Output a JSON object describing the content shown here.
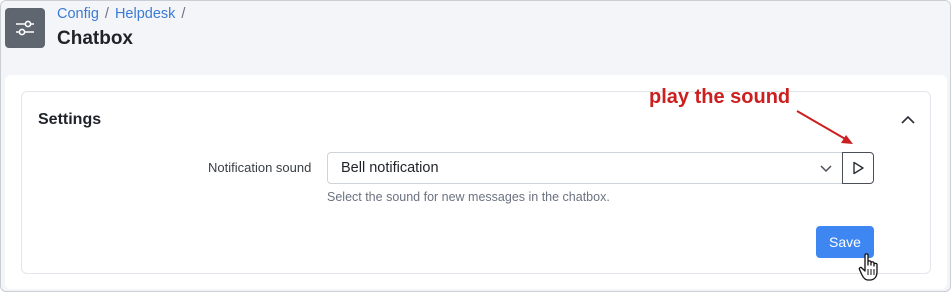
{
  "breadcrumb": {
    "items": [
      "Config",
      "Helpdesk"
    ],
    "separator": "/"
  },
  "page": {
    "title": "Chatbox"
  },
  "settings": {
    "title": "Settings",
    "notification_label": "Notification sound",
    "selected_sound": "Bell notification",
    "help_text": "Select the sound for new messages in the chatbox.",
    "save_label": "Save"
  },
  "annotation": {
    "text": "play the sound",
    "color": "#cc1f1f"
  },
  "icons": {
    "app": "sliders-icon",
    "collapse": "chevron-up-icon",
    "select": "chevron-down-icon",
    "play": "play-icon",
    "cursor": "hand-pointer-icon"
  },
  "colors": {
    "accent": "#3e86f2",
    "link": "#3a7bd5"
  }
}
